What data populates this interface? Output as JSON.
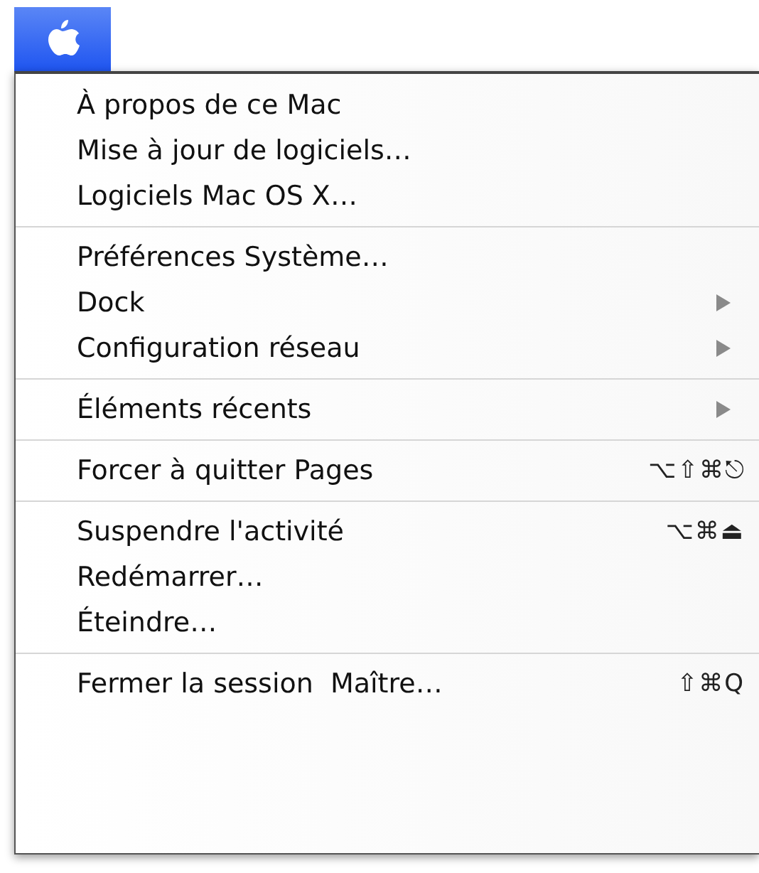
{
  "menu_bar": {
    "apple_menu": {
      "selected": true
    }
  },
  "menu": {
    "groups": [
      {
        "items": [
          {
            "label": "À propos de ce Mac",
            "submenu": false
          },
          {
            "label": "Mise à jour de logiciels…",
            "submenu": false
          },
          {
            "label": "Logiciels Mac OS X…",
            "submenu": false
          }
        ]
      },
      {
        "items": [
          {
            "label": "Préférences Système…",
            "submenu": false
          },
          {
            "label": "Dock",
            "submenu": true
          },
          {
            "label": "Configuration réseau",
            "submenu": true
          }
        ]
      },
      {
        "items": [
          {
            "label": "Éléments récents",
            "submenu": true
          }
        ]
      },
      {
        "items": [
          {
            "label": "Forcer à quitter Pages",
            "shortcut": "⌥⇧⌘⎋",
            "submenu": false
          }
        ]
      },
      {
        "items": [
          {
            "label": "Suspendre l'activité",
            "shortcut": "⌥⌘⏏",
            "submenu": false
          },
          {
            "label": "Redémarrer…",
            "submenu": false
          },
          {
            "label": "Éteindre…",
            "submenu": false
          }
        ]
      },
      {
        "items": [
          {
            "label": "Fermer la session  Maître…",
            "shortcut": "⇧⌘Q",
            "submenu": false
          }
        ]
      }
    ]
  }
}
